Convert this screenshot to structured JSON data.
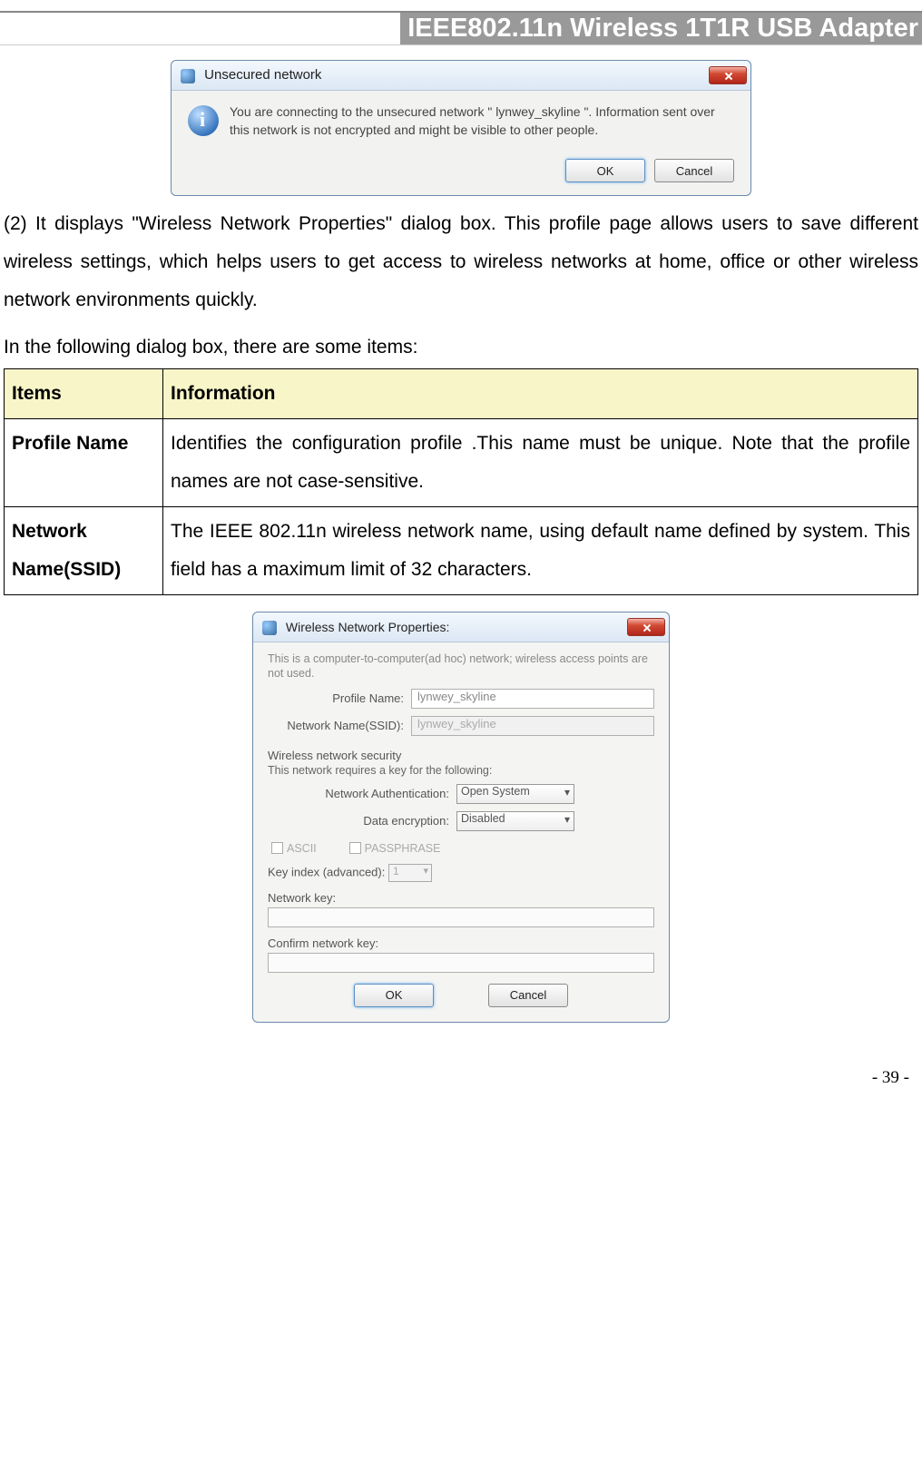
{
  "header": {
    "title": "IEEE802.11n Wireless 1T1R USB Adapter"
  },
  "dialog1": {
    "title": "Unsecured network",
    "message": "You are connecting to the unsecured network \" lynwey_skyline \". Information sent over this network is not encrypted and might be visible to other people.",
    "ok": "OK",
    "cancel": "Cancel"
  },
  "para1": "(2) It displays \"Wireless Network Properties\" dialog box. This profile page allows users to save different wireless settings, which helps users to get access to wireless networks at home, office or other wireless network environments quickly.",
  "para2": "In the following dialog box, there are some items:",
  "table": {
    "head_items": "Items",
    "head_info": "Information",
    "rows": [
      {
        "item": "Profile Name",
        "info": "Identifies the configuration profile .This name must be unique. Note that the profile names are not case-sensitive."
      },
      {
        "item": "Network Name(SSID)",
        "info": "The IEEE 802.11n wireless network name, using default name defined by system. This field has a maximum limit of 32 characters."
      }
    ]
  },
  "dialog2": {
    "title": "Wireless Network Properties:",
    "adhoc_note": "This is a computer-to-computer(ad hoc) network; wireless access points are not used.",
    "profile_label": "Profile Name:",
    "profile_value": "lynwey_skyline",
    "ssid_label": "Network Name(SSID):",
    "ssid_value": "lynwey_skyline",
    "security_header": "Wireless network security",
    "security_note": "This network requires a key for the following:",
    "auth_label": "Network Authentication:",
    "auth_value": "Open System",
    "enc_label": "Data encryption:",
    "enc_value": "Disabled",
    "ascii": "ASCII",
    "passphrase": "PASSPHRASE",
    "keyindex_label": "Key index (advanced):",
    "keyindex_value": "1",
    "netkey_label": "Network key:",
    "confirm_label": "Confirm network key:",
    "ok": "OK",
    "cancel": "Cancel"
  },
  "page_number": "- 39 -"
}
